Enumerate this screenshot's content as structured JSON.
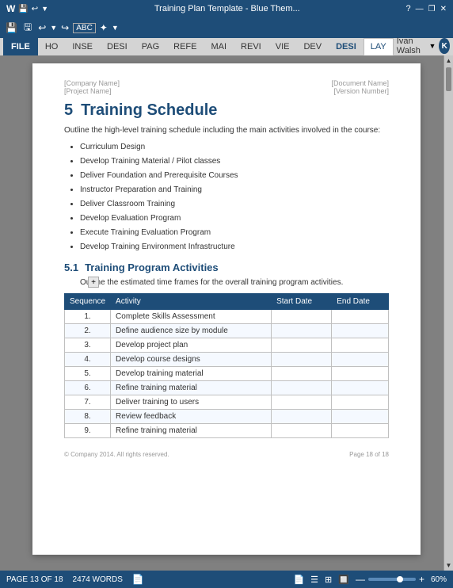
{
  "titlebar": {
    "title": "Training Plan Template - Blue Them...",
    "help_icon": "?",
    "min_btn": "—",
    "restore_btn": "❐",
    "close_btn": "✕"
  },
  "ribbon_tools": [
    "💾",
    "💾",
    "↩",
    "↩",
    "ABC",
    "✦",
    "▼"
  ],
  "tabs": [
    {
      "label": "FILE",
      "type": "file"
    },
    {
      "label": "HO",
      "type": "normal"
    },
    {
      "label": "INSE",
      "type": "normal"
    },
    {
      "label": "DESI",
      "type": "normal"
    },
    {
      "label": "PAG",
      "type": "normal"
    },
    {
      "label": "REFE",
      "type": "normal"
    },
    {
      "label": "MAI",
      "type": "normal"
    },
    {
      "label": "REVI",
      "type": "normal"
    },
    {
      "label": "VIE",
      "type": "normal"
    },
    {
      "label": "DEV",
      "type": "normal"
    },
    {
      "label": "DESI",
      "type": "highlighted"
    },
    {
      "label": "LAY",
      "type": "active"
    }
  ],
  "user": {
    "name": "Ivan Walsh",
    "avatar": "K"
  },
  "page": {
    "meta": {
      "company": "[Company Name]",
      "project": "[Project Name]",
      "document": "[Document Name]",
      "version": "[Version Number]"
    },
    "section": {
      "number": "5",
      "title": "Training Schedule",
      "description": "Outline the high-level training schedule including the main activities involved in the course:"
    },
    "bullets": [
      "Curriculum Design",
      "Develop Training Material / Pilot classes",
      "Deliver Foundation and Prerequisite Courses",
      "Instructor Preparation and Training",
      "Deliver Classroom Training",
      "Develop Evaluation Program",
      "Execute Training Evaluation Program",
      "Develop Training Environment Infrastructure"
    ],
    "subsection": {
      "number": "5.1",
      "title": "Training Program Activities",
      "description": "Outline the estimated time frames for the overall training program activities."
    },
    "table": {
      "headers": [
        "Sequence",
        "Activity",
        "Start Date",
        "End Date"
      ],
      "rows": [
        {
          "seq": "1.",
          "activity": "Complete Skills Assessment",
          "start": "",
          "end": ""
        },
        {
          "seq": "2.",
          "activity": "Define audience size by module",
          "start": "",
          "end": ""
        },
        {
          "seq": "3.",
          "activity": "Develop project plan",
          "start": "",
          "end": ""
        },
        {
          "seq": "4.",
          "activity": "Develop course designs",
          "start": "",
          "end": ""
        },
        {
          "seq": "5.",
          "activity": "Develop training material",
          "start": "",
          "end": ""
        },
        {
          "seq": "6.",
          "activity": "Refine training material",
          "start": "",
          "end": ""
        },
        {
          "seq": "7.",
          "activity": "Deliver training to users",
          "start": "",
          "end": ""
        },
        {
          "seq": "8.",
          "activity": "Review feedback",
          "start": "",
          "end": ""
        },
        {
          "seq": "9.",
          "activity": "Refine training material",
          "start": "",
          "end": ""
        }
      ]
    },
    "footer": {
      "copyright": "© Company 2014. All rights reserved.",
      "page": "Page 18 of 18"
    }
  },
  "statusbar": {
    "page_info": "PAGE 13 OF 18",
    "word_count": "2474 WORDS",
    "zoom": "60%",
    "zoom_minus": "—",
    "zoom_plus": "+"
  }
}
